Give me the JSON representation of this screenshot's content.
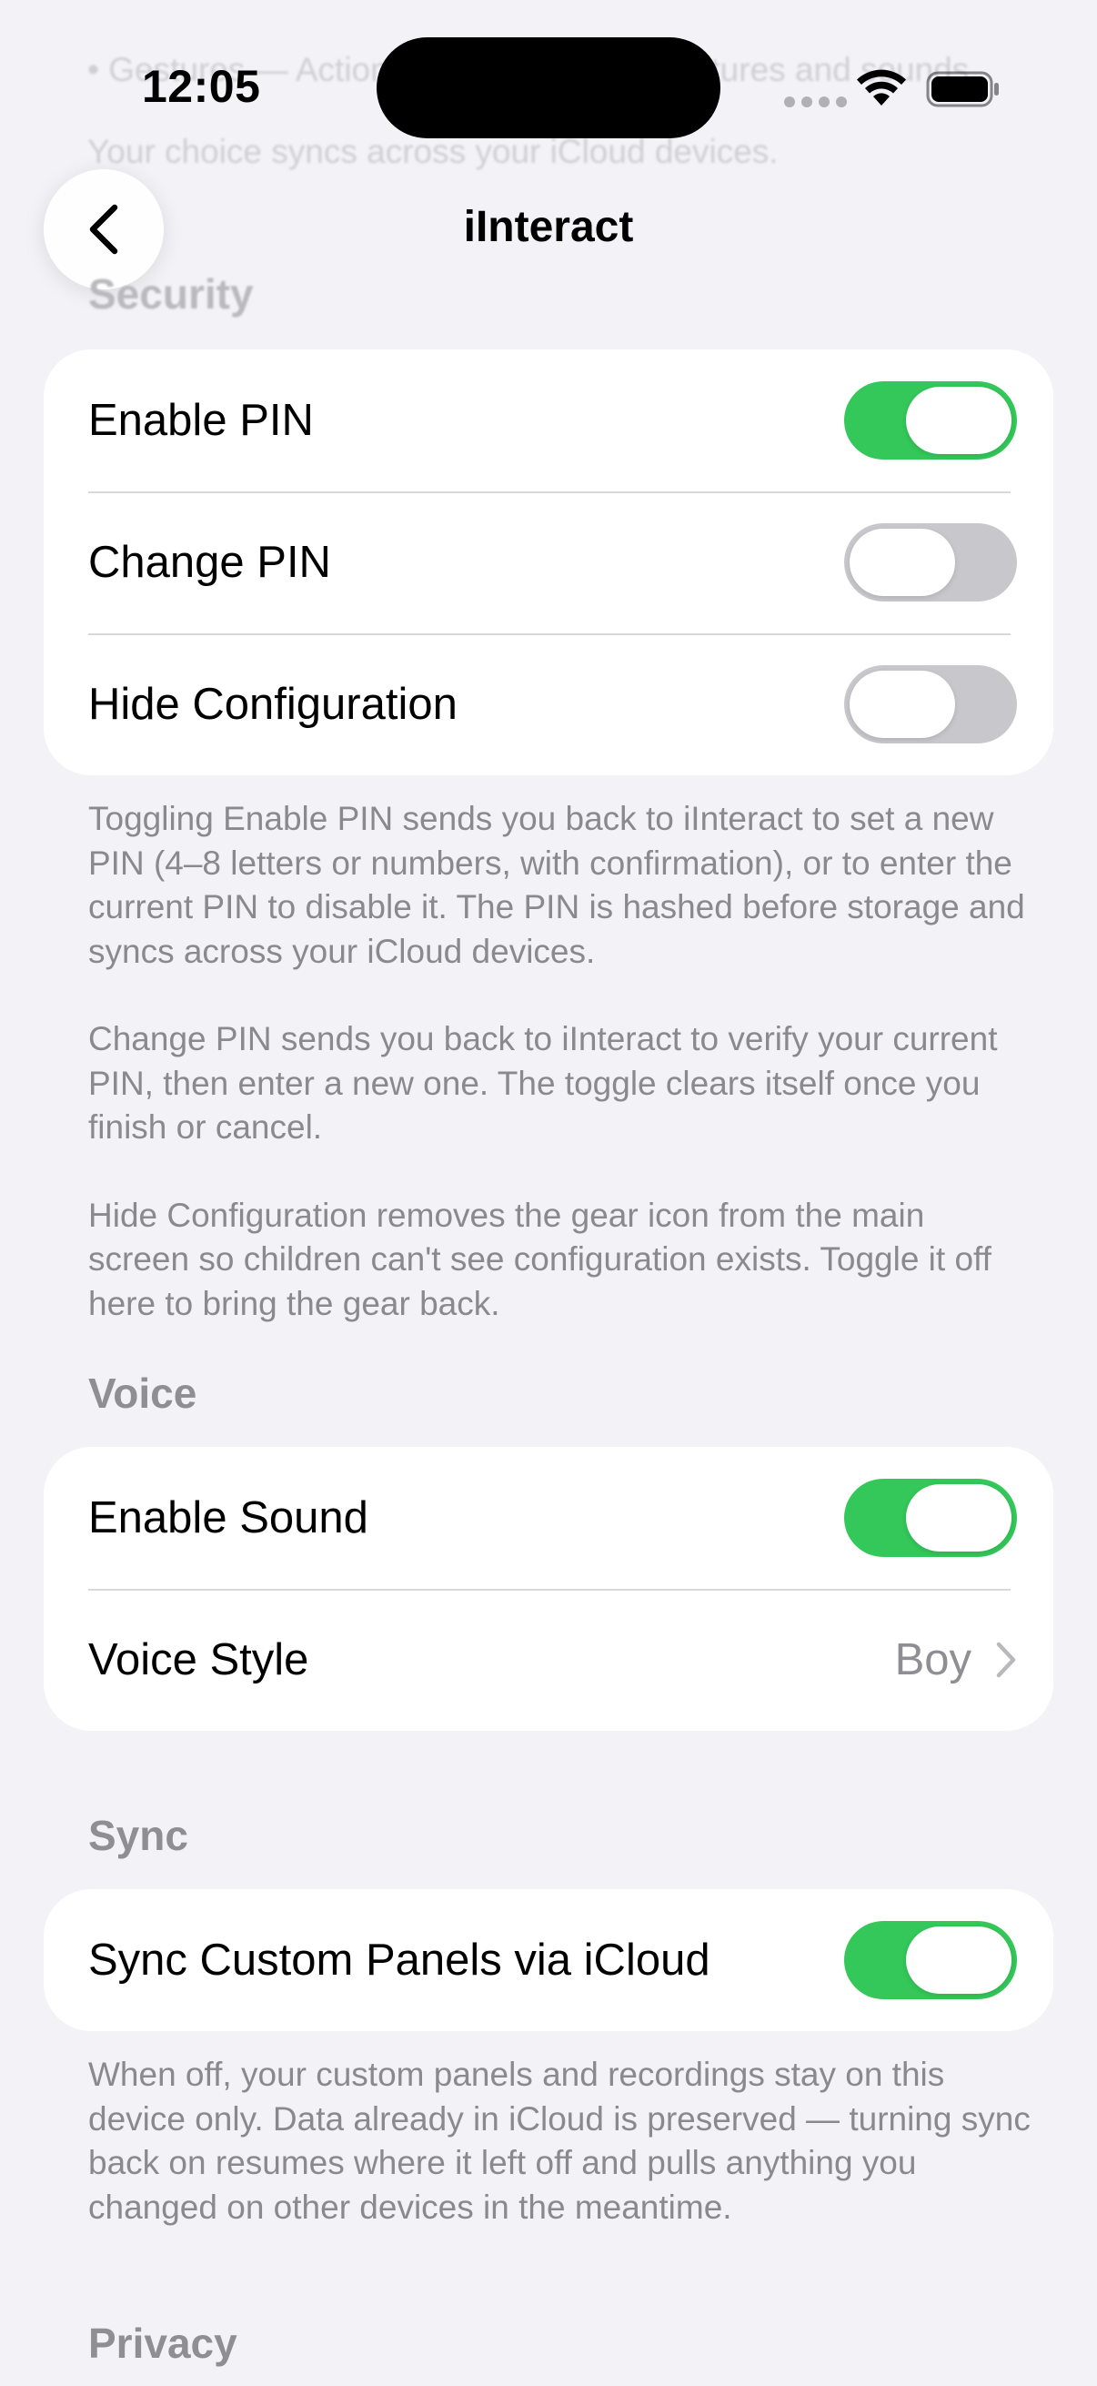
{
  "status_bar": {
    "time": "12:05"
  },
  "nav": {
    "title": "iInteract"
  },
  "behind_text": {
    "line1": "• Gestures — Actions linked to custom pictures and sounds.",
    "line2": "Your choice syncs across your iCloud devices."
  },
  "security": {
    "header": "Security",
    "rows": [
      {
        "label": "Enable PIN",
        "on": true
      },
      {
        "label": "Change PIN",
        "on": false
      },
      {
        "label": "Hide Configuration",
        "on": false
      }
    ],
    "footer": [
      "Toggling Enable PIN sends you back to iInteract to set a new PIN (4–8 letters or numbers, with confirmation), or to enter the current PIN to disable it. The PIN is hashed before storage and syncs across your iCloud devices.",
      "Change PIN sends you back to iInteract to verify your current PIN, then enter a new one. The toggle clears itself once you finish or cancel.",
      "Hide Configuration removes the gear icon from the main screen so children can't see configuration exists. Toggle it off here to bring the gear back."
    ]
  },
  "voice": {
    "header": "Voice",
    "enable_sound": {
      "label": "Enable Sound",
      "on": true
    },
    "voice_style": {
      "label": "Voice Style",
      "value": "Boy"
    }
  },
  "sync": {
    "header": "Sync",
    "sync_panels": {
      "label": "Sync Custom Panels via iCloud",
      "on": true
    },
    "footer": "When off, your custom panels and recordings stay on this device only. Data already in iCloud is preserved — turning sync back on resumes where it left off and pulls anything you changed on other devices in the meantime."
  },
  "privacy": {
    "header": "Privacy"
  },
  "colors": {
    "toggle_on": "#34c759",
    "toggle_off": "#c8c8cc",
    "background": "#f2f2f7",
    "secondary_text": "#8e8e93"
  }
}
